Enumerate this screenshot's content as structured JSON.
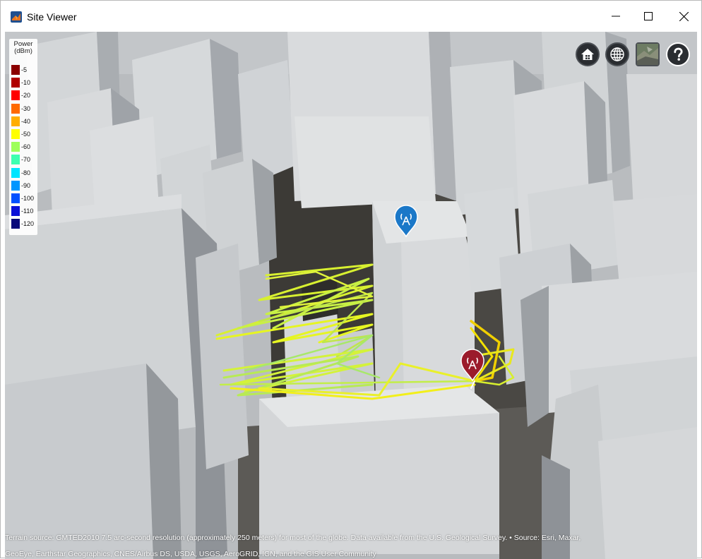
{
  "window": {
    "title": "Site Viewer",
    "controls": {
      "minimize": "minimize-icon",
      "maximize": "maximize-icon",
      "close": "close-icon"
    }
  },
  "legend": {
    "title_line1": "Power",
    "title_line2": "(dBm)",
    "entries": [
      {
        "label": "-5",
        "color": "#8b0000"
      },
      {
        "label": "-10",
        "color": "#b00000"
      },
      {
        "label": "-20",
        "color": "#ff0000"
      },
      {
        "label": "-30",
        "color": "#ff6a00"
      },
      {
        "label": "-40",
        "color": "#ffae00"
      },
      {
        "label": "-50",
        "color": "#ffff00"
      },
      {
        "label": "-60",
        "color": "#9dff5a"
      },
      {
        "label": "-70",
        "color": "#3dffb0"
      },
      {
        "label": "-80",
        "color": "#00e5ff"
      },
      {
        "label": "-90",
        "color": "#0096ff"
      },
      {
        "label": "-100",
        "color": "#0050ff"
      },
      {
        "label": "-110",
        "color": "#0a10d8"
      },
      {
        "label": "-120",
        "color": "#08087a"
      }
    ]
  },
  "toolbar": {
    "home": "home-icon",
    "globe": "globe-icon",
    "basemap": "basemap-thumbnail",
    "help": "help-icon"
  },
  "markers": {
    "transmitter_color": "#1b78c8",
    "receiver_color": "#9b1b2b"
  },
  "attribution": {
    "line1": "Terrain source: GMTED2010 7.5 arc-second resolution (approximately 250 meters) for most of the globe. Data available from the U.S. Geological Survey. • Source: Esri, Maxar,",
    "line2": "GeoEye, Earthstar Geographics, CNES/Airbus DS, USDA, USGS, AeroGRID, IGN, and the GIS User Community"
  }
}
